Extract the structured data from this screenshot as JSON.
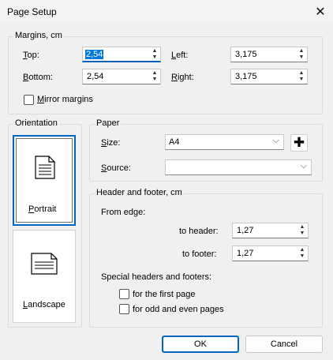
{
  "window": {
    "title": "Page Setup",
    "close_glyph": "✕"
  },
  "margins": {
    "group_label": "Margins, cm",
    "top_label": "Top:",
    "top_value": "2,54",
    "left_label": "Left:",
    "left_value": "3,175",
    "bottom_label": "Bottom:",
    "bottom_value": "2,54",
    "right_label": "Right:",
    "right_value": "3,175",
    "mirror_label": "Mirror margins",
    "mirror_checked": false
  },
  "orientation": {
    "group_label": "Orientation",
    "portrait_label": "Portrait",
    "landscape_label": "Landscape",
    "selected": "Portrait"
  },
  "paper": {
    "group_label": "Paper",
    "size_label": "Size:",
    "size_value": "A4",
    "source_label": "Source:",
    "source_value": "",
    "add_glyph": "✚"
  },
  "header_footer": {
    "group_label": "Header and footer, cm",
    "from_edge_label": "From edge:",
    "to_header_label": "to header:",
    "to_header_value": "1,27",
    "to_footer_label": "to footer:",
    "to_footer_value": "1,27",
    "special_label": "Special headers and footers:",
    "first_page_label": "for the first page",
    "first_page_checked": false,
    "odd_even_label": "for odd and even pages",
    "odd_even_checked": false
  },
  "buttons": {
    "ok": "OK",
    "cancel": "Cancel"
  },
  "icons": {
    "spin_up": "▲",
    "spin_down": "▼",
    "chevron": "⌵"
  }
}
